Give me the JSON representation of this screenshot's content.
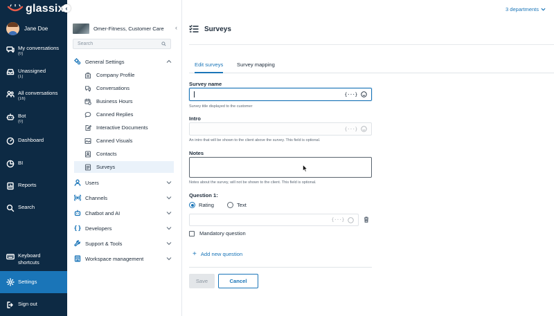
{
  "brand": {
    "name": "glassix"
  },
  "user": {
    "name": "Jane Doe"
  },
  "nav": {
    "items": [
      {
        "key": "my-conversations",
        "label": "My conversations",
        "count": "(0)",
        "icon": "chat-icon"
      },
      {
        "key": "unassigned",
        "label": "Unassigned",
        "count": "(1)",
        "icon": "inbox-icon"
      },
      {
        "key": "all-conversations",
        "label": "All conversations",
        "count": "(16)",
        "icon": "people-icon"
      },
      {
        "key": "bot",
        "label": "Bot",
        "count": "(0)",
        "icon": "bot-icon"
      },
      {
        "key": "dashboard",
        "label": "Dashboard",
        "count": "",
        "icon": "dashboard-icon"
      },
      {
        "key": "bi",
        "label": "BI",
        "count": "",
        "icon": "bi-icon"
      },
      {
        "key": "reports",
        "label": "Reports",
        "count": "",
        "icon": "reports-icon"
      },
      {
        "key": "search",
        "label": "Search",
        "count": "",
        "icon": "search-icon"
      }
    ],
    "bottom": [
      {
        "key": "keyboard-shortcuts",
        "label": "Keyboard shortcuts",
        "icon": "keyboard-icon"
      },
      {
        "key": "settings",
        "label": "Settings",
        "icon": "gear-icon",
        "active": true
      },
      {
        "key": "sign-out",
        "label": "Sign out",
        "icon": "sign-out-icon"
      }
    ]
  },
  "workspace": {
    "name": "Omer-Fitness, Customer Care"
  },
  "settings_search": {
    "placeholder": "Search"
  },
  "settings_nav": {
    "general": {
      "label": "General Settings",
      "items": [
        {
          "label": "Company Profile",
          "icon": "building-icon"
        },
        {
          "label": "Conversations",
          "icon": "chat-icon"
        },
        {
          "label": "Business Hours",
          "icon": "calendar-clock-icon"
        },
        {
          "label": "Canned Replies",
          "icon": "reply-bubble-icon"
        },
        {
          "label": "Interactive Documents",
          "icon": "edit-document-icon"
        },
        {
          "label": "Canned Visuals",
          "icon": "image-icon"
        },
        {
          "label": "Contacts",
          "icon": "contact-card-icon"
        },
        {
          "label": "Surveys",
          "icon": "survey-icon",
          "active": true
        }
      ]
    },
    "groups": [
      {
        "label": "Users",
        "icon": "user-icon"
      },
      {
        "label": "Channels",
        "icon": "channels-icon"
      },
      {
        "label": "Chatbot and AI",
        "icon": "chatbot-icon"
      },
      {
        "label": "Developers",
        "icon": "code-icon"
      },
      {
        "label": "Support & Tools",
        "icon": "tools-icon"
      },
      {
        "label": "Workspace management",
        "icon": "workspace-icon"
      }
    ]
  },
  "departments": {
    "label": "3 departments"
  },
  "page": {
    "title": "Surveys"
  },
  "tabs": [
    {
      "label": "Edit surveys",
      "active": true
    },
    {
      "label": "Survey mapping",
      "active": false
    }
  ],
  "form": {
    "survey_name": {
      "label": "Survey name",
      "value": "",
      "hint": "Survey title displayed to the customer"
    },
    "intro": {
      "label": "Intro",
      "value": "",
      "hint": "An intro that will be shown to the client above the survey. This field is optional."
    },
    "notes": {
      "label": "Notes",
      "value": "",
      "hint": "Notes about the survey, will not be shown to the client. This field is optional."
    },
    "question": {
      "label": "Question 1:",
      "type_options": [
        {
          "label": "Rating",
          "selected": true
        },
        {
          "label": "Text",
          "selected": false
        }
      ],
      "value": "",
      "mandatory_label": "Mandatory question",
      "mandatory": false
    },
    "variables_glyph": "{···}",
    "add_question_label": "Add new question",
    "save_label": "Save",
    "cancel_label": "Cancel"
  },
  "colors": {
    "nav_bg": "#0d2a44",
    "accent": "#1a75b8",
    "active_nav": "#1a75b8"
  }
}
